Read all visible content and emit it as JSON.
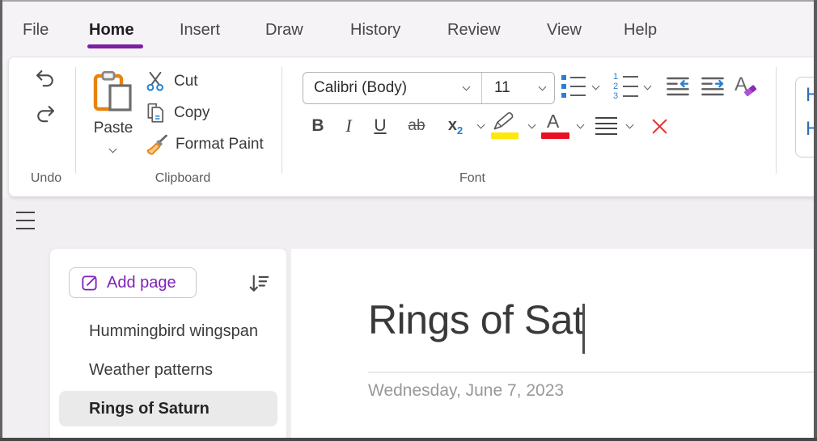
{
  "menu": {
    "items": [
      {
        "label": "File",
        "active": false
      },
      {
        "label": "Home",
        "active": true
      },
      {
        "label": "Insert",
        "active": false
      },
      {
        "label": "Draw",
        "active": false
      },
      {
        "label": "History",
        "active": false
      },
      {
        "label": "Review",
        "active": false
      },
      {
        "label": "View",
        "active": false
      },
      {
        "label": "Help",
        "active": false
      }
    ]
  },
  "ribbon": {
    "undo_group": {
      "label": "Undo"
    },
    "clipboard_group": {
      "label": "Clipboard",
      "paste_label": "Paste",
      "cut_label": "Cut",
      "copy_label": "Copy",
      "format_paint_label": "Format Paint"
    },
    "font_group": {
      "label": "Font",
      "font_family": "Calibri (Body)",
      "font_size": "11",
      "bold_glyph": "B",
      "italic_glyph": "I",
      "underline_glyph": "U",
      "strikethrough_glyph": "ab",
      "subscript_base": "x",
      "subscript_sub": "2",
      "clear_format_glyph": "A",
      "numbered_glyphs": [
        "1",
        "2",
        "3"
      ]
    },
    "styles_pane": {
      "visible_items": [
        "H",
        "H"
      ]
    }
  },
  "page_panel": {
    "add_page_label": "Add page",
    "pages": [
      {
        "title": "Hummingbird wingspan",
        "selected": false
      },
      {
        "title": "Weather patterns",
        "selected": false
      },
      {
        "title": "Rings of Saturn",
        "selected": true
      }
    ]
  },
  "editor": {
    "title": "Rings of Sat",
    "date": "Wednesday, June 7, 2023"
  },
  "icons": {
    "undo": "undo-arrow",
    "redo": "redo-arrow",
    "paste": "clipboard",
    "cut": "scissors",
    "copy": "pages",
    "format_paint": "brush",
    "bullets": "bullet-list",
    "numbering": "numbered-list",
    "outdent": "decrease-indent",
    "indent": "increase-indent",
    "clear_format": "letter-with-eraser",
    "highlight": "highlighter-pen",
    "font_color": "letter-with-red-bar",
    "align": "align-lines",
    "delete": "red-x",
    "navigation": "hamburger",
    "add_page": "compose-square",
    "sort": "sort-descending-arrow",
    "caret": "text-cursor"
  },
  "colors": {
    "accent_purple": "#7a1fa2",
    "accent_blue": "#2a7fd4",
    "accent_orange": "#e8820e",
    "highlight_yellow": "#fce80a",
    "font_color_red": "#e81123",
    "delete_red": "#e8312a",
    "heading_blue": "#2e6fb7",
    "selected_page_bg": "#ebeaeb"
  }
}
